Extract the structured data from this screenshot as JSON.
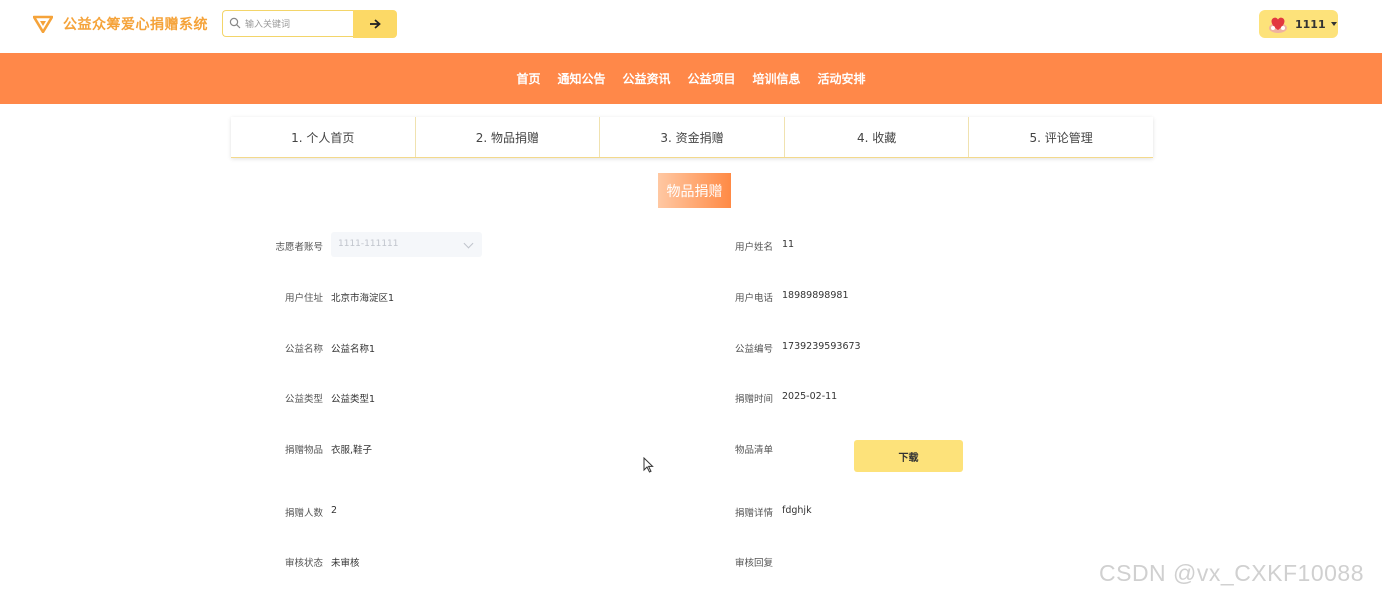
{
  "header": {
    "site_title": "公益众筹爱心捐赠系统",
    "search_placeholder": "输入关键词",
    "user_name": "1111"
  },
  "nav": {
    "items": [
      {
        "label": "首页"
      },
      {
        "label": "通知公告"
      },
      {
        "label": "公益资讯"
      },
      {
        "label": "公益项目"
      },
      {
        "label": "培训信息"
      },
      {
        "label": "活动安排"
      }
    ]
  },
  "tabs": [
    {
      "label": "1. 个人首页"
    },
    {
      "label": "2. 物品捐赠"
    },
    {
      "label": "3. 资金捐赠"
    },
    {
      "label": "4. 收藏"
    },
    {
      "label": "5. 评论管理"
    }
  ],
  "section_title": "物品捐赠",
  "form": {
    "volunteer_account": {
      "label": "志愿者账号",
      "value": "1111-111111"
    },
    "user_name": {
      "label": "用户姓名",
      "value": "11"
    },
    "user_address": {
      "label": "用户住址",
      "value": "北京市海淀区1"
    },
    "user_phone": {
      "label": "用户电话",
      "value": "18989898981"
    },
    "charity_name": {
      "label": "公益名称",
      "value": "公益名称1"
    },
    "charity_code": {
      "label": "公益编号",
      "value": "1739239593673"
    },
    "charity_type": {
      "label": "公益类型",
      "value": "公益类型1"
    },
    "donation_time": {
      "label": "捐赠时间",
      "value": "2025-02-11"
    },
    "donated_items": {
      "label": "捐赠物品",
      "value": "衣服,鞋子"
    },
    "item_list": {
      "label": "物品清单",
      "button": "下载"
    },
    "donor_count": {
      "label": "捐赠人数",
      "value": "2"
    },
    "donation_detail": {
      "label": "捐赠详情",
      "value": "fdghjk"
    },
    "review_status": {
      "label": "审核状态",
      "value": "未审核"
    },
    "review_reply": {
      "label": "审核回复",
      "value": ""
    }
  },
  "watermark": "CSDN @vx_CXKF10088",
  "colors": {
    "brand": "#f5a33a",
    "nav_bg": "#ff8849",
    "accent_yellow": "#fde27a"
  }
}
